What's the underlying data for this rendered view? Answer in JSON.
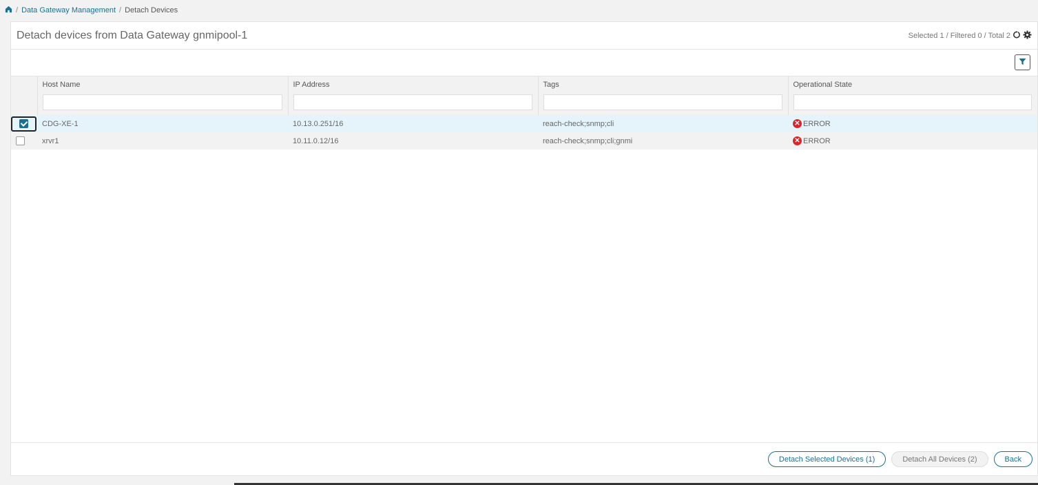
{
  "breadcrumb": {
    "home_icon": "home-icon",
    "items": [
      "Data Gateway Management",
      "Detach Devices"
    ]
  },
  "header": {
    "title": "Detach devices from Data Gateway gnmipool-1",
    "counts": "Selected 1 / Filtered 0 / Total 2"
  },
  "table": {
    "columns": [
      "Host Name",
      "IP Address",
      "Tags",
      "Operational State"
    ],
    "rows": [
      {
        "selected": true,
        "host": "CDG-XE-1",
        "ip": "10.13.0.251/16",
        "tags": "reach-check;snmp;cli",
        "state": "ERROR"
      },
      {
        "selected": false,
        "host": "xrvr1",
        "ip": "10.11.0.12/16",
        "tags": "reach-check;snmp;cli;gnmi",
        "state": "ERROR"
      }
    ]
  },
  "footer": {
    "detach_selected": "Detach Selected Devices (1)",
    "detach_all": "Detach All Devices (2)",
    "back": "Back"
  },
  "colors": {
    "accent": "#1c6f91",
    "error": "#d9262a",
    "selected_row": "#e5f3fa"
  }
}
